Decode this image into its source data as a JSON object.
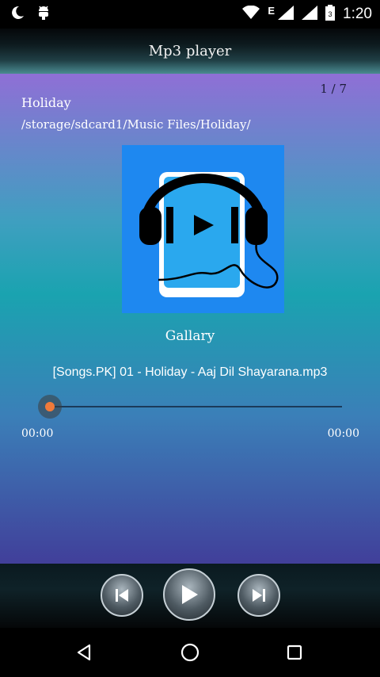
{
  "status_bar": {
    "time": "1:20",
    "network_type": "E",
    "icons": [
      "moon-icon",
      "android-debug-icon",
      "wifi-icon",
      "signal-icon",
      "signal-icon-2",
      "battery-icon"
    ]
  },
  "app_bar": {
    "title": "Mp3 player"
  },
  "track": {
    "counter": "1 / 7",
    "album": "Holiday",
    "path": "/storage/sdcard1/Music Files/Holiday/",
    "art_caption": "Gallary",
    "filename": "[Songs.PK] 01 - Holiday - Aaj Dil Shayarana.mp3",
    "progress": 0,
    "elapsed": "00:00",
    "duration": "00:00"
  },
  "controls": {
    "prev_icon": "skip-previous-icon",
    "play_icon": "play-icon",
    "next_icon": "skip-next-icon"
  },
  "nav_bar": {
    "icons": [
      "back-icon",
      "home-icon",
      "recents-icon"
    ]
  },
  "colors": {
    "seek_thumb": "#f07a3a",
    "art_background": "#1e88f0",
    "gradient_top": "#8f6fd6",
    "gradient_bottom": "#413f9a"
  }
}
